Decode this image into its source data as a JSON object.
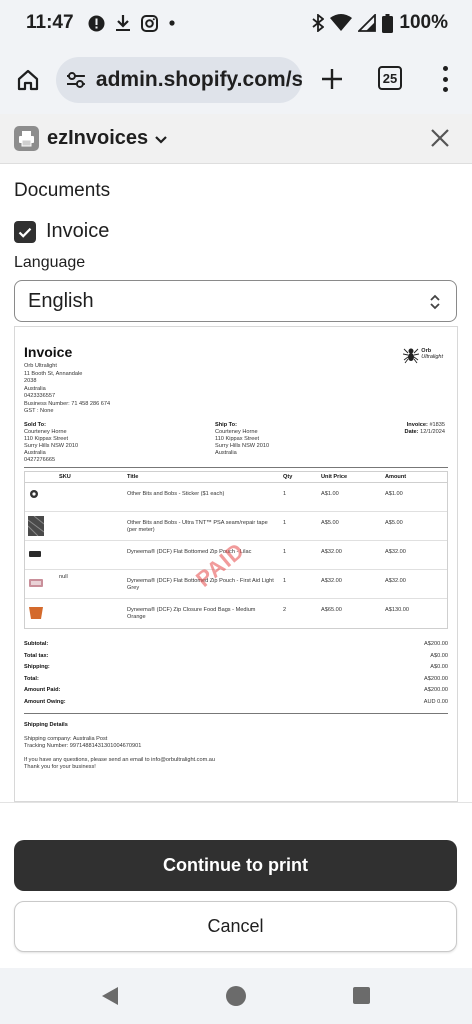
{
  "status_bar": {
    "time": "11:47",
    "battery": "100%"
  },
  "browser": {
    "url": "admin.shopify.com/s",
    "tab_count": "25"
  },
  "app": {
    "name": "ezInvoices"
  },
  "documents": {
    "title": "Documents",
    "invoice_label": "Invoice",
    "invoice_checked": true,
    "language_label": "Language",
    "language_value": "English"
  },
  "invoice": {
    "title": "Invoice",
    "from": [
      "Orb Ultralight",
      "11 Booth St, Annandale",
      "2038",
      "Australia",
      "0423336557",
      "Business Number: 71 458 286 674",
      "GST : None"
    ],
    "logo_text": [
      "Orb",
      "Ultralight"
    ],
    "sold_to_label": "Sold To:",
    "sold_to": [
      "Courteney Horne",
      "110 Kippax Street",
      "Surry Hills NSW 2010",
      "Australia",
      "0427276665"
    ],
    "ship_to_label": "Ship To:",
    "ship_to": [
      "Courteney Horne",
      "110 Kippax Street",
      "Surry Hills NSW 2010",
      "Australia"
    ],
    "invoice_no_label": "Invoice:",
    "invoice_no": "#1835",
    "date_label": "Date:",
    "date": "12/1/2024",
    "columns": [
      "SKU",
      "Title",
      "Qty",
      "Unit Price",
      "Amount"
    ],
    "items": [
      {
        "sku": "",
        "title": "Other Bits and Bobs - Sticker ($1 each)",
        "qty": "1",
        "unit_price": "A$1.00",
        "amount": "A$1.00",
        "thumb": "sticker"
      },
      {
        "sku": "",
        "title": "Other Bits and Bobs - Ultra TNT™ PSA seam/repair tape (per meter)",
        "qty": "1",
        "unit_price": "A$5.00",
        "amount": "A$5.00",
        "thumb": "tape"
      },
      {
        "sku": "",
        "title": "Dyneema® (DCF) Flat Bottomed Zip Pouch - Lilac",
        "qty": "1",
        "unit_price": "A$32.00",
        "amount": "A$32.00",
        "thumb": "pouch-dark"
      },
      {
        "sku": "null",
        "title": "Dyneema® (DCF) Flat Bottomed Zip Pouch - First Aid Light Grey",
        "qty": "1",
        "unit_price": "A$32.00",
        "amount": "A$32.00",
        "thumb": "pouch-pink"
      },
      {
        "sku": "",
        "title": "Dyneema® (DCF) Zip Closure Food Bags - Medium Orange",
        "qty": "2",
        "unit_price": "A$65.00",
        "amount": "A$130.00",
        "thumb": "bag-orange"
      }
    ],
    "stamp": "PAID",
    "totals": [
      {
        "label": "Subtotal:",
        "value": "A$200.00"
      },
      {
        "label": "Total tax:",
        "value": "A$0.00"
      },
      {
        "label": "Shipping:",
        "value": "A$0.00"
      },
      {
        "label": "Total:",
        "value": "A$200.00"
      },
      {
        "label": "Amount Paid:",
        "value": "A$200.00"
      },
      {
        "label": "Amount Owing:",
        "value": "AUD 0.00"
      }
    ],
    "shipping_details_title": "Shipping Details",
    "shipping_company": "Shipping company: Australia Post",
    "tracking": "Tracking Number: 99714881431301004670901",
    "questions": "If you have any questions, please send an email to info@orbultralight.com.au",
    "thanks": "Thank you for your business!"
  },
  "footer": {
    "continue_label": "Continue to print",
    "cancel_label": "Cancel"
  },
  "colors": {
    "primary_button": "#303030",
    "stamp": "#e54848",
    "chrome_bg": "#f1f3f6"
  }
}
